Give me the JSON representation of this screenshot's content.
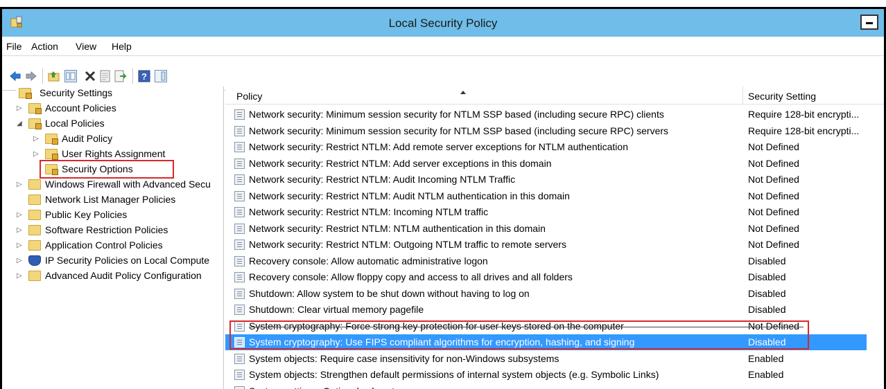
{
  "window": {
    "title": "Local Security Policy",
    "accent_color": "#6fbde8",
    "selection_color": "#3399ff",
    "annotation_color": "#d9262e"
  },
  "menu": [
    "File",
    "Action",
    "View",
    "Help"
  ],
  "toolbar": {
    "icons": [
      "back-arrow-icon",
      "forward-arrow-icon",
      "up-folder-icon",
      "show-hide-tree-icon",
      "delete-icon",
      "properties-icon",
      "export-list-icon",
      "help-icon",
      "show-hide-action-pane-icon"
    ]
  },
  "tree": {
    "root": "Security Settings",
    "items": [
      {
        "label": "Account Policies",
        "level": 1,
        "expander": "collapsed",
        "icon": "folder-lock"
      },
      {
        "label": "Local Policies",
        "level": 1,
        "expander": "expanded",
        "icon": "folder-lock"
      },
      {
        "label": "Audit Policy",
        "level": 2,
        "expander": "collapsed",
        "icon": "folder-lock"
      },
      {
        "label": "User Rights Assignment",
        "level": 2,
        "expander": "collapsed",
        "icon": "folder-lock"
      },
      {
        "label": "Security Options",
        "level": 2,
        "expander": "none",
        "icon": "folder-lock"
      },
      {
        "label": "Windows Firewall with Advanced Secu",
        "level": 1,
        "expander": "collapsed",
        "icon": "folder"
      },
      {
        "label": "Network List Manager Policies",
        "level": 1,
        "expander": "none",
        "icon": "folder"
      },
      {
        "label": "Public Key Policies",
        "level": 1,
        "expander": "collapsed",
        "icon": "folder"
      },
      {
        "label": "Software Restriction Policies",
        "level": 1,
        "expander": "collapsed",
        "icon": "folder"
      },
      {
        "label": "Application Control Policies",
        "level": 1,
        "expander": "collapsed",
        "icon": "folder"
      },
      {
        "label": "IP Security Policies on Local Compute",
        "level": 1,
        "expander": "collapsed",
        "icon": "shield"
      },
      {
        "label": "Advanced Audit Policy Configuration",
        "level": 1,
        "expander": "collapsed",
        "icon": "folder"
      }
    ]
  },
  "list": {
    "columns": [
      "Policy",
      "Security Setting"
    ],
    "rows": [
      {
        "policy": "Network security: Minimum session security for NTLM SSP based (including secure RPC) clients",
        "setting": "Require 128-bit encrypti..."
      },
      {
        "policy": "Network security: Minimum session security for NTLM SSP based (including secure RPC) servers",
        "setting": "Require 128-bit encrypti..."
      },
      {
        "policy": "Network security: Restrict NTLM: Add remote server exceptions for NTLM authentication",
        "setting": "Not Defined"
      },
      {
        "policy": "Network security: Restrict NTLM: Add server exceptions in this domain",
        "setting": "Not Defined"
      },
      {
        "policy": "Network security: Restrict NTLM: Audit Incoming NTLM Traffic",
        "setting": "Not Defined"
      },
      {
        "policy": "Network security: Restrict NTLM: Audit NTLM authentication in this domain",
        "setting": "Not Defined"
      },
      {
        "policy": "Network security: Restrict NTLM: Incoming NTLM traffic",
        "setting": "Not Defined"
      },
      {
        "policy": "Network security: Restrict NTLM: NTLM authentication in this domain",
        "setting": "Not Defined"
      },
      {
        "policy": "Network security: Restrict NTLM: Outgoing NTLM traffic to remote servers",
        "setting": "Not Defined"
      },
      {
        "policy": "Recovery console: Allow automatic administrative logon",
        "setting": "Disabled"
      },
      {
        "policy": "Recovery console: Allow floppy copy and access to all drives and all folders",
        "setting": "Disabled"
      },
      {
        "policy": "Shutdown: Allow system to be shut down without having to log on",
        "setting": "Disabled"
      },
      {
        "policy": "Shutdown: Clear virtual memory pagefile",
        "setting": "Disabled"
      },
      {
        "policy": "System cryptography: Force strong key protection for user keys stored on the computer",
        "setting": "Not Defined"
      },
      {
        "policy": "System cryptography: Use FIPS compliant algorithms for encryption, hashing, and signing",
        "setting": "Disabled"
      },
      {
        "policy": "System objects: Require case insensitivity for non-Windows subsystems",
        "setting": "Enabled"
      },
      {
        "policy": "System objects: Strengthen default permissions of internal system objects (e.g. Symbolic Links)",
        "setting": "Enabled"
      },
      {
        "policy": "System settings: Optional subsystems",
        "setting": ""
      }
    ]
  }
}
